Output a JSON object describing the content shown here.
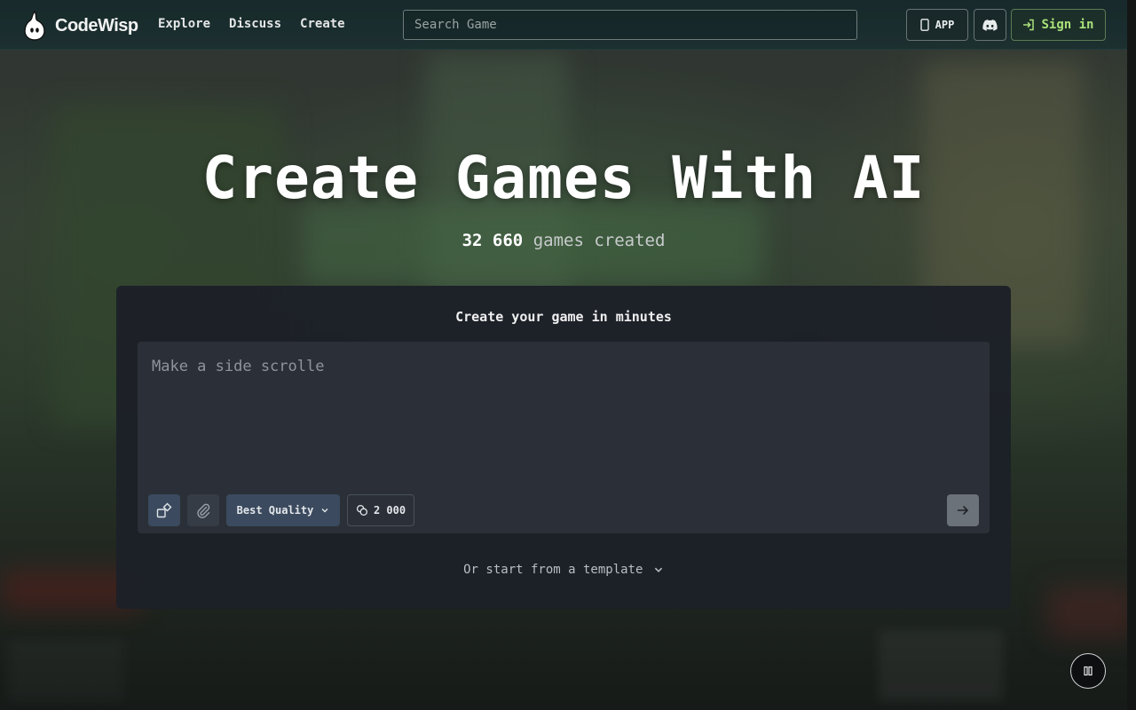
{
  "brand": {
    "name": "CodeWisp"
  },
  "nav": {
    "items": [
      "Explore",
      "Discuss",
      "Create"
    ]
  },
  "search": {
    "placeholder": "Search Game"
  },
  "header_buttons": {
    "app_label": "APP",
    "signin_label": "Sign in"
  },
  "hero": {
    "title": "Create Games With AI",
    "games_count": "32 660",
    "games_suffix": "games created"
  },
  "card": {
    "title": "Create your game in minutes",
    "prompt_value": "Make a side scrolle",
    "quality_label": "Best Quality",
    "credits": "2 000",
    "template_label": "Or start from a template"
  },
  "icons": {
    "logo": "wisp-ghost-icon",
    "app": "phone-icon",
    "discord": "discord-icon",
    "signin": "sign-in-icon",
    "mode": "shapes-icon",
    "attach": "paperclip-icon",
    "quality_chevron": "chevron-down-icon",
    "credits": "coins-icon",
    "send": "arrow-right-icon",
    "template_chevron": "chevron-down-icon",
    "pause": "pause-icon"
  },
  "colors": {
    "accent_green": "#a9e07a",
    "card_bg": "#1c2028",
    "button_blue": "#3b4a5e"
  }
}
